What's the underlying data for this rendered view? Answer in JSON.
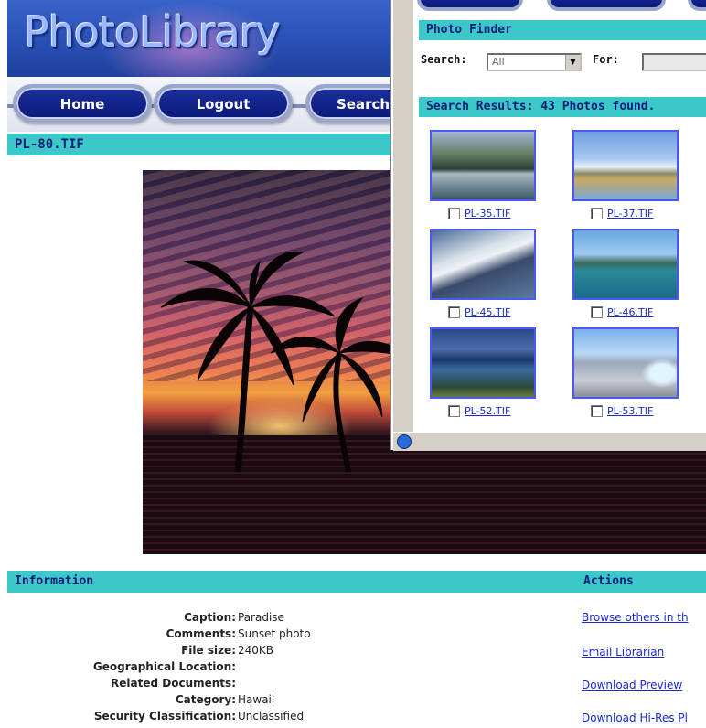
{
  "app": {
    "logo_text": "PhotoLibrary"
  },
  "nav": {
    "home": "Home",
    "logout": "Logout",
    "search": "Search"
  },
  "photo": {
    "filename": "PL-80.TIF"
  },
  "information": {
    "header": "Information",
    "fields": [
      {
        "label": "Caption:",
        "value": "Paradise"
      },
      {
        "label": "Comments:",
        "value": "Sunset photo"
      },
      {
        "label": "File size:",
        "value": "240KB"
      },
      {
        "label": "Geographical Location:",
        "value": ""
      },
      {
        "label": "Related Documents:",
        "value": ""
      },
      {
        "label": "Category:",
        "value": "Hawaii"
      },
      {
        "label": "Security Classification:",
        "value": "Unclassified"
      }
    ]
  },
  "actions": {
    "header": "Actions",
    "links": [
      "Browse others in th",
      "Email Librarian",
      "Download Preview",
      "Download Hi-Res Pl"
    ]
  },
  "finder": {
    "header": "Photo Finder",
    "search_label": "Search:",
    "search_value": "All",
    "for_label": "For:",
    "for_value": ""
  },
  "results": {
    "header": "Search Results: 43 Photos found.",
    "items": [
      {
        "name": "PL-35.TIF",
        "scene": "harbor"
      },
      {
        "name": "PL-37.TIF",
        "scene": "mountain"
      },
      {
        "name": "PL-45.TIF",
        "scene": "boat"
      },
      {
        "name": "PL-46.TIF",
        "scene": "lake"
      },
      {
        "name": "PL-52.TIF",
        "scene": "river"
      },
      {
        "name": "PL-53.TIF",
        "scene": "iceberg"
      }
    ]
  },
  "colors": {
    "accent_teal": "#3cc8c8",
    "nav_blue": "#0b1a7a",
    "link_blue": "#1a2ad0"
  }
}
